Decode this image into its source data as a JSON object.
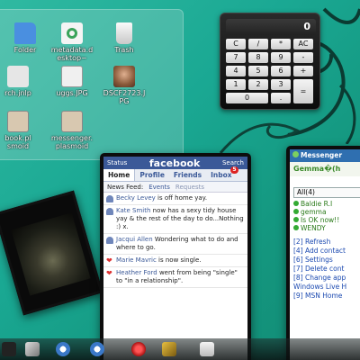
{
  "desktop": {
    "icons": [
      {
        "label": "Folder",
        "icon": "folder-icon",
        "color": "#4a8fe0"
      },
      {
        "label": "metadata.d\nesktop~",
        "icon": "recycle-doc-icon",
        "color": "#3aa35a"
      },
      {
        "label": "Trash",
        "icon": "trash-icon",
        "color": "#e8e8e8"
      },
      {
        "label": "rch.jnlp",
        "icon": "jnlp-file-icon",
        "color": "#cfcfcf"
      },
      {
        "label": "uggs.JPG",
        "icon": "image-file-icon",
        "color": "#e0e0e0"
      },
      {
        "label": "DSCF2723.J\nPG",
        "icon": "photo-file-icon",
        "color": "#b08060"
      },
      {
        "label": "book.pl\nsmoid",
        "icon": "plasmoid-file-icon",
        "color": "#d8c8b0"
      },
      {
        "label": "messenger.\nplasmoid",
        "icon": "plasmoid-file-icon",
        "color": "#d8c8b0"
      }
    ]
  },
  "calculator": {
    "display": "0",
    "keys": [
      "C",
      "/",
      "*",
      "AC",
      "7",
      "8",
      "9",
      "-",
      "4",
      "5",
      "6",
      "+",
      "1",
      "2",
      "3",
      "=",
      "0",
      "."
    ]
  },
  "facebook": {
    "status_label": "Status",
    "brand": "facebook",
    "search_label": "Search",
    "tabs": [
      "Home",
      "Profile",
      "Friends",
      "Inbox"
    ],
    "inbox_count": "5",
    "subtabs": [
      "News Feed:",
      "Events",
      "Requests"
    ],
    "posts": [
      {
        "who": "Becky Levey",
        "text": " is off home yay.",
        "kind": "person"
      },
      {
        "who": "Kate Smith",
        "text": " now has a sexy tidy house yay & the rest of the day to do...Nothing :) x.",
        "kind": "person"
      },
      {
        "who": "Jacqui Allen",
        "text": " Wondering what to do and where to go.",
        "kind": "person"
      },
      {
        "who": "Marie Mavric",
        "text": " is now single.",
        "kind": "heart"
      },
      {
        "who": "Heather Ford",
        "text": " went from being \"single\" to \"in a relationship\".",
        "kind": "heart"
      }
    ]
  },
  "messenger": {
    "title": "Messenger",
    "nickname": "Gemma�(h",
    "group": "All(4)",
    "contacts": [
      "Baldie R.I",
      "gemma",
      "Is OK now!!",
      "WENDY"
    ],
    "links": [
      "[2] Refresh",
      "[4] Add contact",
      "[6] Settings",
      "[7] Delete cont",
      "[8] Change app",
      "Windows Live H",
      "[9] MSN Home"
    ]
  },
  "taskbar": {
    "items": [
      "kickoff-icon",
      "window-icon",
      "plasmoid-icon",
      "plasmoid-icon",
      "browser-icon",
      "tools-icon",
      "notes-icon"
    ]
  }
}
